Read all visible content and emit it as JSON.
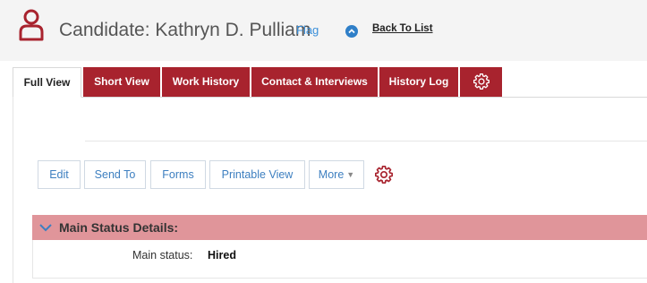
{
  "header": {
    "prefix": "Candidate:",
    "name": "Kathryn D. Pulliam",
    "flag_label": "Flag",
    "back_label": "Back To List",
    "accent_color": "#a8232e",
    "link_color": "#3b8fd9",
    "person_icon": "person-outline-icon",
    "back_icon": "chevron-up-circle-icon"
  },
  "tabs": [
    {
      "label": "Full View",
      "active": true
    },
    {
      "label": "Short View",
      "active": false
    },
    {
      "label": "Work History",
      "active": false
    },
    {
      "label": "Contact & Interviews",
      "active": false
    },
    {
      "label": "History Log",
      "active": false
    },
    {
      "icon": "gear-icon"
    }
  ],
  "toolbar": {
    "edit": "Edit",
    "send_to": "Send To",
    "forms": "Forms",
    "printable_view": "Printable View",
    "more": "More",
    "settings_icon": "gear-icon"
  },
  "section": {
    "title": "Main Status Details:",
    "header_color": "#e0959a",
    "fields": [
      {
        "label": "Main status:",
        "value": "Hired"
      }
    ]
  }
}
